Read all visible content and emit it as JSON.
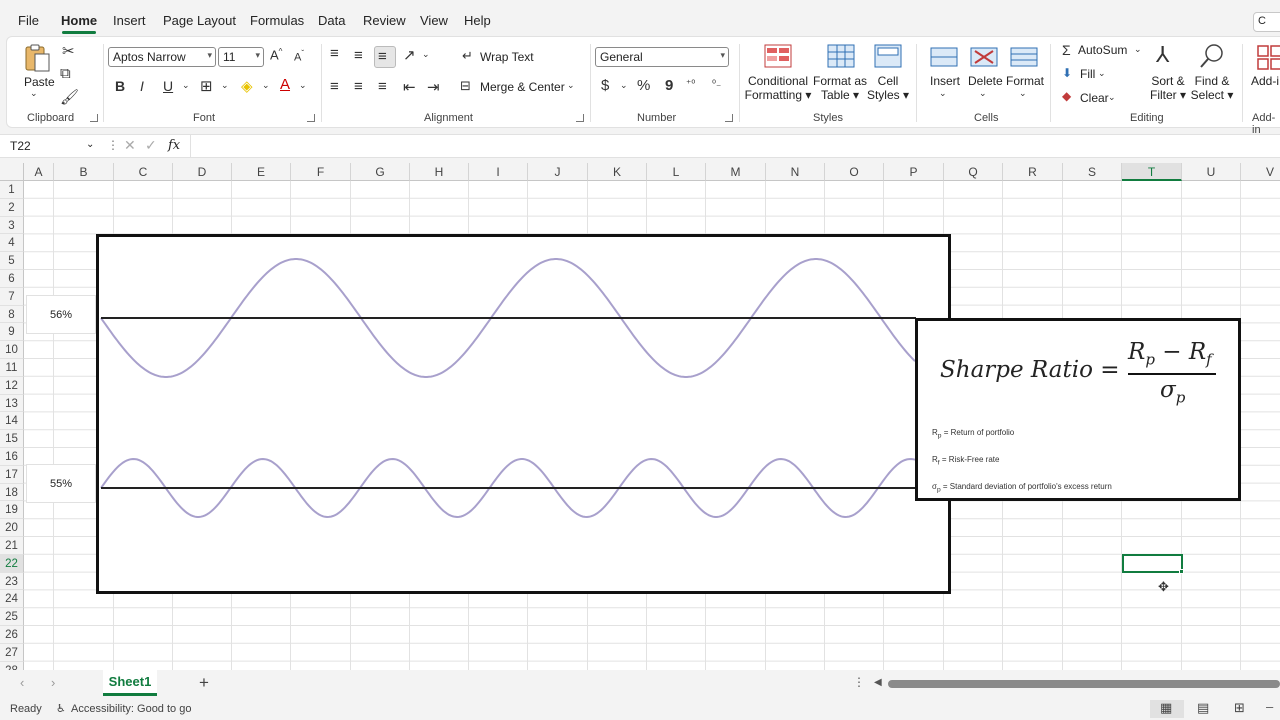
{
  "menu": {
    "tabs": [
      "File",
      "Home",
      "Insert",
      "Page Layout",
      "Formulas",
      "Data",
      "Review",
      "View",
      "Help"
    ],
    "active": "Home",
    "comments_label": "C"
  },
  "ribbon": {
    "clipboard": {
      "paste_label": "Paste",
      "group_label": "Clipboard"
    },
    "font": {
      "font_name": "Aptos Narrow",
      "font_size": "11",
      "group_label": "Font",
      "bold": "B",
      "italic": "I",
      "underline": "U"
    },
    "alignment": {
      "wrap_text": "Wrap Text",
      "merge_center": "Merge & Center",
      "group_label": "Alignment"
    },
    "number": {
      "format": "General",
      "group_label": "Number",
      "currency": "$",
      "percent": "%",
      "comma": "9"
    },
    "styles": {
      "conditional_formatting": [
        "Conditional",
        "Formatting"
      ],
      "format_as_table": [
        "Format as",
        "Table"
      ],
      "cell_styles": [
        "Cell",
        "Styles"
      ],
      "group_label": "Styles"
    },
    "cells": {
      "insert": "Insert",
      "delete": "Delete",
      "format": "Format",
      "group_label": "Cells"
    },
    "editing": {
      "autosum": "AutoSum",
      "fill": "Fill",
      "clear": "Clear",
      "sort_filter": [
        "Sort &",
        "Filter"
      ],
      "find_select": [
        "Find &",
        "Select"
      ],
      "group_label": "Editing"
    },
    "addins": {
      "label": "Add-i",
      "group_label": "Add-in"
    }
  },
  "formula_bar": {
    "name_box": "T22",
    "fx": "fx",
    "content": ""
  },
  "grid": {
    "columns": [
      "A",
      "B",
      "C",
      "D",
      "E",
      "F",
      "G",
      "H",
      "I",
      "J",
      "K",
      "L",
      "M",
      "N",
      "O",
      "P",
      "Q",
      "R",
      "S",
      "T",
      "U",
      "V"
    ],
    "rows": [
      "1",
      "2",
      "3",
      "4",
      "5",
      "6",
      "7",
      "8",
      "9",
      "10",
      "11",
      "12",
      "13",
      "14",
      "15",
      "16",
      "17",
      "18",
      "19",
      "20",
      "21",
      "22",
      "23",
      "24",
      "25",
      "26",
      "27",
      "28"
    ],
    "selected_column": "T",
    "selected_row": "22"
  },
  "chart": {
    "label_top": "56%",
    "label_bottom": "55%",
    "wave_color": "#a8a0cc"
  },
  "formula_box": {
    "title": "Sharpe Ratio =",
    "numerator_a": "R",
    "numerator_a_sub": "p",
    "numerator_minus": "−",
    "numerator_b": "R",
    "numerator_b_sub": "f",
    "denominator": "σ",
    "denominator_sub": "p",
    "legend": [
      {
        "sym": "R",
        "sub": "p",
        "text": "= Return of portfolio"
      },
      {
        "sym": "R",
        "sub": "f",
        "text": "= Risk-Free rate"
      },
      {
        "sym": "σ",
        "sub": "p",
        "text": "= Standard deviation of portfolio's excess return"
      }
    ]
  },
  "sheet_tabs": {
    "active": "Sheet1",
    "add": "+"
  },
  "status": {
    "ready": "Ready",
    "accessibility": "Accessibility: Good to go"
  },
  "colors": {
    "accent": "#117c3f",
    "selection_border": "#117c3f"
  }
}
